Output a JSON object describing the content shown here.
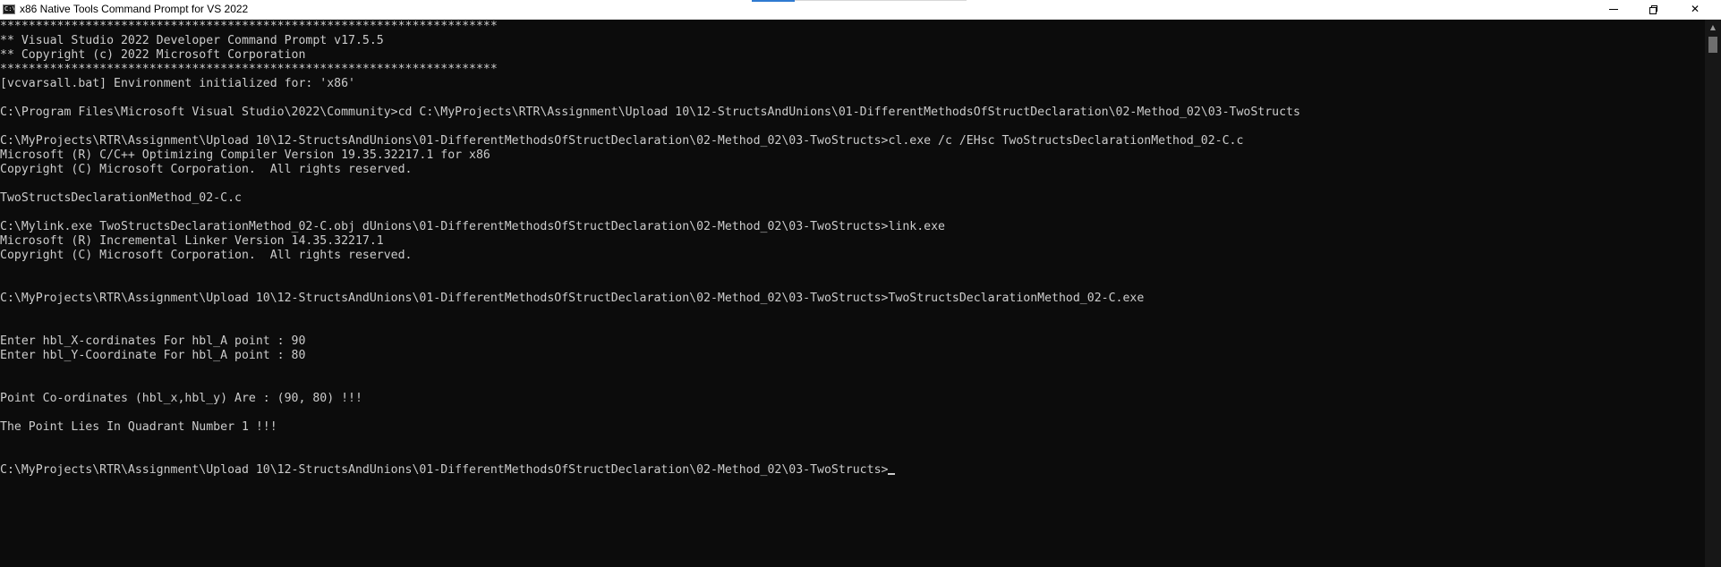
{
  "window": {
    "title": "x86 Native Tools Command Prompt for VS 2022",
    "icon_text": "C:\\",
    "controls": {
      "minimize": "minimize",
      "restore": "restore",
      "close": "✕"
    }
  },
  "console": {
    "lines": [
      "**********************************************************************",
      "** Visual Studio 2022 Developer Command Prompt v17.5.5",
      "** Copyright (c) 2022 Microsoft Corporation",
      "**********************************************************************",
      "[vcvarsall.bat] Environment initialized for: 'x86'",
      "",
      "C:\\Program Files\\Microsoft Visual Studio\\2022\\Community>cd C:\\MyProjects\\RTR\\Assignment\\Upload 10\\12-StructsAndUnions\\01-DifferentMethodsOfStructDeclaration\\02-Method_02\\03-TwoStructs",
      "",
      "C:\\MyProjects\\RTR\\Assignment\\Upload 10\\12-StructsAndUnions\\01-DifferentMethodsOfStructDeclaration\\02-Method_02\\03-TwoStructs>cl.exe /c /EHsc TwoStructsDeclarationMethod_02-C.c",
      "Microsoft (R) C/C++ Optimizing Compiler Version 19.35.32217.1 for x86",
      "Copyright (C) Microsoft Corporation.  All rights reserved.",
      "",
      "TwoStructsDeclarationMethod_02-C.c",
      "",
      "C:\\Mylink.exe TwoStructsDeclarationMethod_02-C.obj dUnions\\01-DifferentMethodsOfStructDeclaration\\02-Method_02\\03-TwoStructs>link.exe",
      "Microsoft (R) Incremental Linker Version 14.35.32217.1",
      "Copyright (C) Microsoft Corporation.  All rights reserved.",
      "",
      "",
      "C:\\MyProjects\\RTR\\Assignment\\Upload 10\\12-StructsAndUnions\\01-DifferentMethodsOfStructDeclaration\\02-Method_02\\03-TwoStructs>TwoStructsDeclarationMethod_02-C.exe",
      "",
      "",
      "Enter hbl_X-cordinates For hbl_A point : 90",
      "Enter hbl_Y-Coordinate For hbl_A point : 80",
      "",
      "",
      "Point Co-ordinates (hbl_x,hbl_y) Are : (90, 80) !!!",
      "",
      "The Point Lies In Quadrant Number 1 !!!",
      "",
      "",
      "C:\\MyProjects\\RTR\\Assignment\\Upload 10\\12-StructsAndUnions\\01-DifferentMethodsOfStructDeclaration\\02-Method_02\\03-TwoStructs>"
    ]
  },
  "scrollbar": {
    "up_arrow": "▲"
  }
}
